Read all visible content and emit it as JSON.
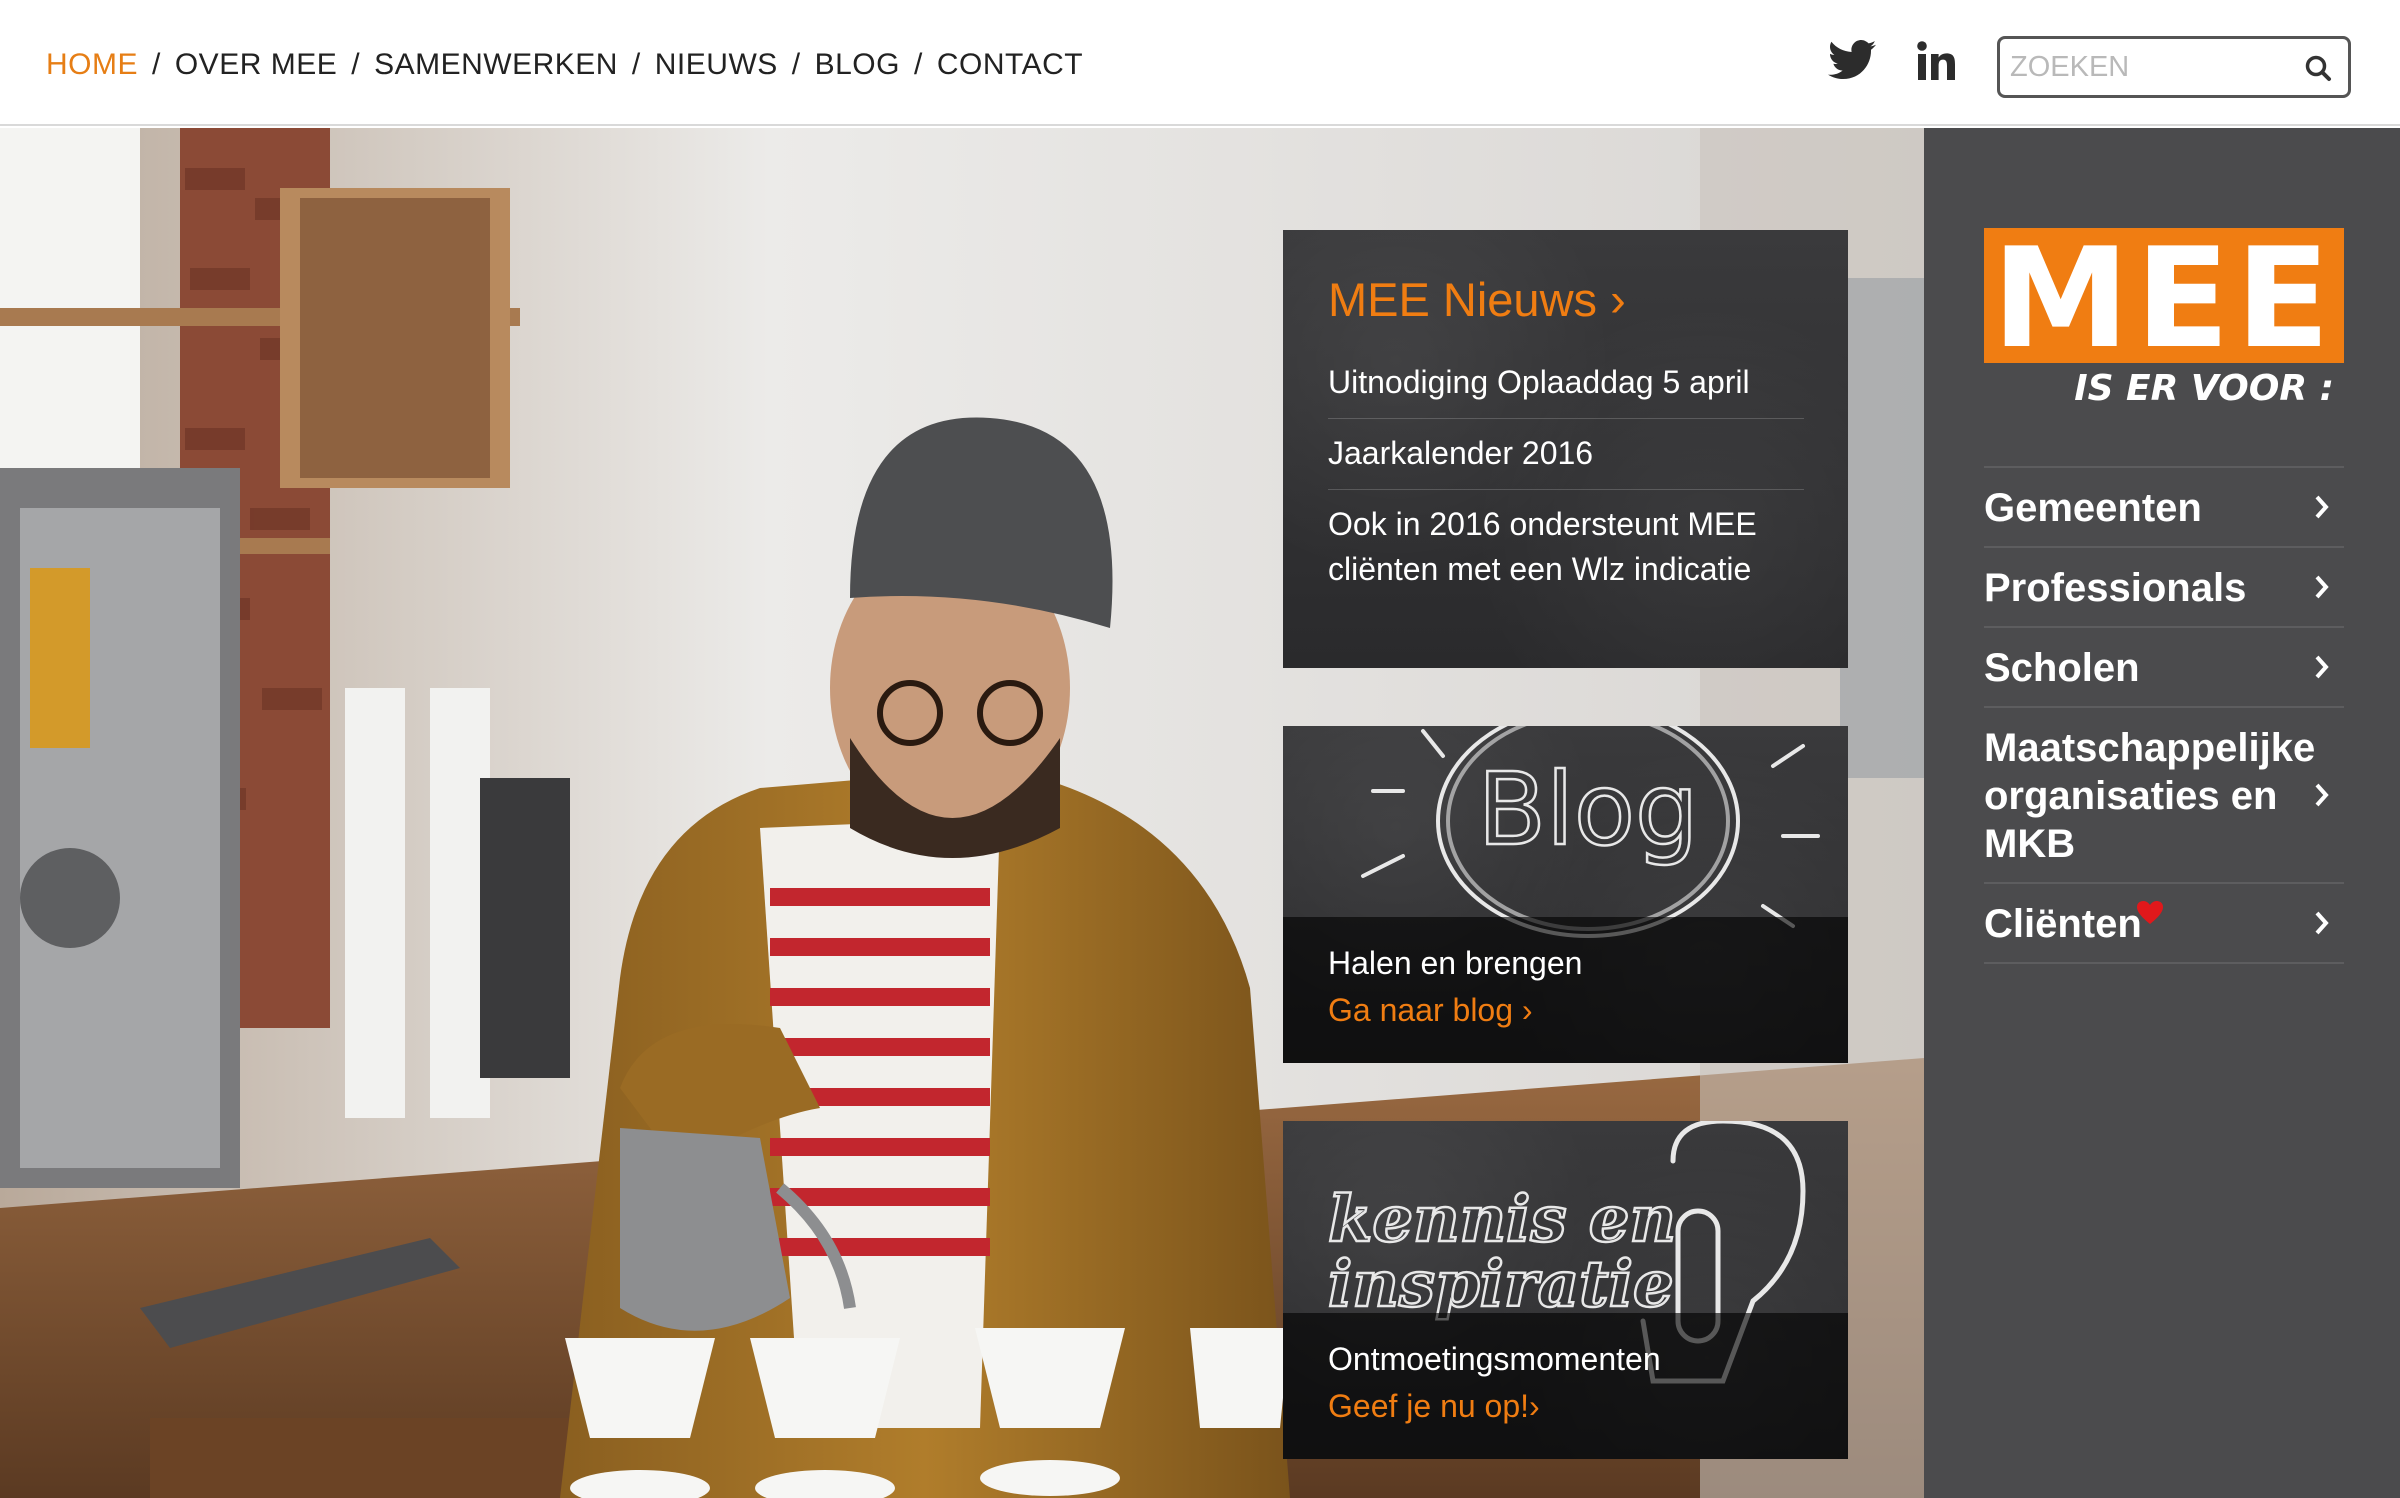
{
  "nav": {
    "items": [
      "HOME",
      "OVER MEE",
      "SAMENWERKEN",
      "NIEUWS",
      "BLOG",
      "CONTACT"
    ],
    "separator": "/",
    "active_color": "#e67e15"
  },
  "social": {
    "twitter_icon": "twitter-icon",
    "linkedin_icon": "linkedin-icon"
  },
  "search": {
    "placeholder": "ZOEKEN",
    "icon": "search-icon"
  },
  "news": {
    "title": "MEE Nieuws",
    "items": [
      "Uitnodiging Oplaaddag 5 april",
      "Jaarkalender 2016",
      "Ook in 2016 ondersteunt MEE cliënten met een Wlz indicatie"
    ]
  },
  "blog": {
    "image_text": "Blog",
    "caption": "Halen en brengen",
    "cta": "Ga naar blog"
  },
  "kennis": {
    "image_text_1": "kennis en",
    "image_text_2": "inspiratie",
    "caption": "Ontmoetingsmomenten",
    "cta": "Geef je nu op!"
  },
  "logo": {
    "name": "MEE",
    "tagline": "IS ER VOOR :",
    "brand_color": "#f07d12"
  },
  "menu": {
    "items": [
      "Gemeenten",
      "Professionals",
      "Scholen",
      "Maatschappelijke organisaties en MKB",
      "Cliënten"
    ],
    "heart_color": "#e0181b"
  }
}
